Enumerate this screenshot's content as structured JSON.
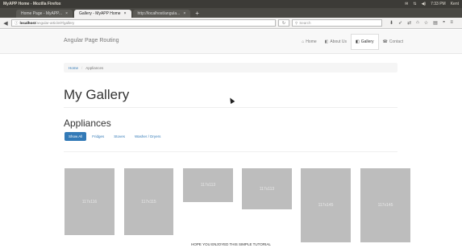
{
  "os": {
    "title": "MyAPP Home - Mozilla Firefox",
    "time": "7:33 PM",
    "user": "Kent"
  },
  "browser": {
    "tabs": [
      {
        "label": "Home Page - MyAPP...",
        "active": false
      },
      {
        "label": "Gallery - MyAPP Home",
        "active": true
      },
      {
        "label": "http://localhost/angula...",
        "active": false
      }
    ],
    "new_tab": "+",
    "url_host": "localhost",
    "url_rest": "/angular-article/#/gallery",
    "search_placeholder": "Search"
  },
  "app": {
    "brand": "Angular Page Routing",
    "menu": [
      {
        "icon": "home-icon",
        "glyph": "⌂",
        "label": "Home",
        "active": false
      },
      {
        "icon": "about-icon",
        "glyph": "◧",
        "label": "About Us",
        "active": false
      },
      {
        "icon": "gallery-icon",
        "glyph": "◧",
        "label": "Gallery",
        "active": true
      },
      {
        "icon": "contact-icon",
        "glyph": "☎",
        "label": "Contact",
        "active": false
      }
    ]
  },
  "breadcrumb": {
    "home": "Home",
    "separator": "/",
    "current": "Appliances"
  },
  "page": {
    "title": "My Gallery",
    "section": "Appliances",
    "filters": [
      "Show All",
      "Fridges",
      "Stoves",
      "Washer / Dryers"
    ],
    "footer": "HOPE YOU ENJOYED THIS SIMPLE TUTORIAL"
  },
  "gallery": {
    "thumbs": [
      {
        "label": "117x116"
      },
      {
        "label": "117x115"
      },
      {
        "label": "117x113"
      },
      {
        "label": "117x113"
      },
      {
        "label": "117x145"
      },
      {
        "label": "117x145"
      }
    ]
  },
  "colors": {
    "primary": "#337ab7",
    "thumb": "#bdbdbd"
  }
}
